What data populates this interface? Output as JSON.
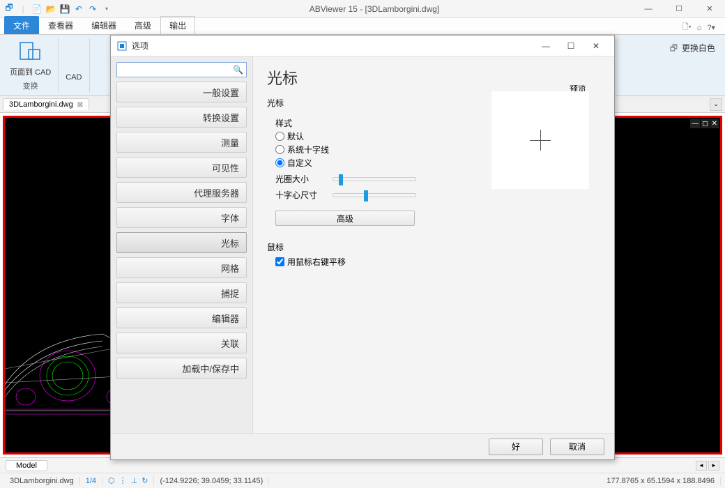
{
  "titlebar": {
    "title": "ABViewer 15 - [3DLamborgini.dwg]"
  },
  "ribbon": {
    "tabs": [
      "文件",
      "查看器",
      "编辑器",
      "高级",
      "输出"
    ],
    "active": 0,
    "group1": {
      "label": "页面到 CAD",
      "footer": "变换"
    },
    "group2": {
      "label": "CAD"
    },
    "right_label": "更换白色"
  },
  "doctab": {
    "name": "3DLamborgini.dwg"
  },
  "bottom": {
    "model": "Model"
  },
  "status": {
    "file": "3DLamborgini.dwg",
    "page": "1/4",
    "coords": "(-124.9226; 39.0459; 33.1145)",
    "dims": "177.8765 x 65.1594 x 188.8496"
  },
  "dialog": {
    "title": "选项",
    "nav": [
      "一般设置",
      "转换设置",
      "测量",
      "可见性",
      "代理服务器",
      "字体",
      "光标",
      "网格",
      "捕捉",
      "编辑器",
      "关联",
      "加载中/保存中"
    ],
    "nav_active": 6,
    "heading": "光标",
    "cursor_group": "光标",
    "style_label": "样式",
    "style_options": [
      "默认",
      "系统十字线",
      "自定义"
    ],
    "style_selected": 2,
    "aperture": "光圈大小",
    "crosshair": "十字心尺寸",
    "advanced": "高级",
    "preview_label": "预览",
    "mouse_group": "鼠标",
    "mouse_check": "用鼠标右键平移",
    "ok": "好",
    "cancel": "取消"
  }
}
